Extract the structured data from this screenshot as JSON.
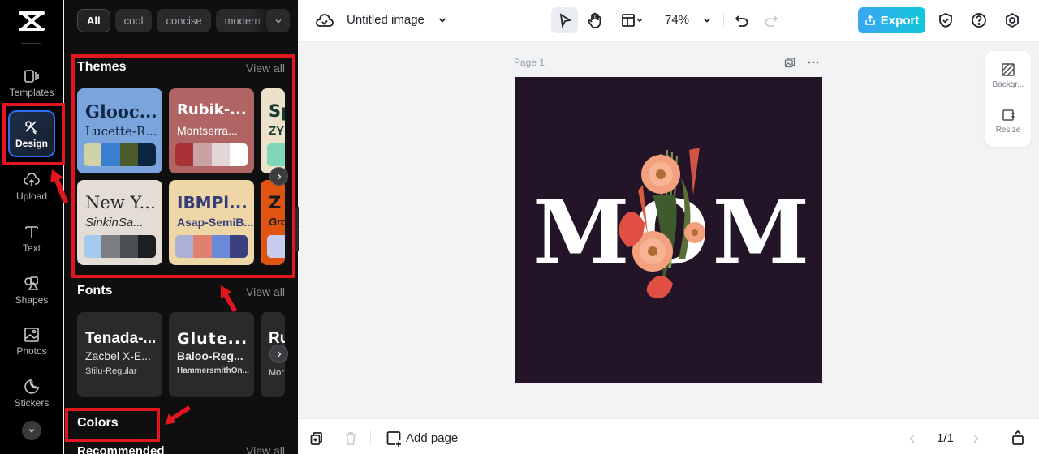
{
  "app": {
    "brand": "CapCut"
  },
  "rail": {
    "items": [
      {
        "label": "Templates",
        "icon": "templates-icon"
      },
      {
        "label": "Design",
        "icon": "design-icon",
        "active": true
      },
      {
        "label": "Upload",
        "icon": "upload-cloud-icon"
      },
      {
        "label": "Text",
        "icon": "text-icon"
      },
      {
        "label": "Shapes",
        "icon": "shapes-icon"
      },
      {
        "label": "Photos",
        "icon": "photos-icon"
      },
      {
        "label": "Stickers",
        "icon": "stickers-icon"
      }
    ],
    "more_icon": "chevron-down-icon"
  },
  "panel": {
    "filter_chips": [
      "All",
      "cool",
      "concise",
      "modern"
    ],
    "active_chip": "All",
    "themes": {
      "title": "Themes",
      "view_all": "View all",
      "cards": [
        {
          "heading": "Glooc...",
          "subheading": "Lucette-R...",
          "bg": "#7aa5dc",
          "fg": "#0f2744",
          "swatches": [
            "#cfd3a6",
            "#3b7fd0",
            "#4a5a2b",
            "#0b2640"
          ]
        },
        {
          "heading": "Rubik-...",
          "subheading": "Montserra...",
          "bg": "#b06464",
          "fg": "#ffffff",
          "swatches": [
            "#a83236",
            "#c9a3a3",
            "#e3d6d6",
            "#ffffff"
          ]
        },
        {
          "heading": "Sp",
          "subheading": "ZY",
          "bg": "#ece2cb",
          "fg": "#163a2f",
          "swatches": [
            "#80d6b8"
          ]
        },
        {
          "heading": "New Y...",
          "subheading": "SinkinSa...",
          "bg": "#e3ddd6",
          "fg": "#2a2a2a",
          "swatches": [
            "#a4c8ee",
            "#7b7e82",
            "#4b4f55",
            "#1c1f22"
          ]
        },
        {
          "heading": "IBMPl...",
          "subheading": "Asap-SemiB...",
          "bg": "#eed6a6",
          "fg": "#363e7a",
          "swatches": [
            "#aab0d6",
            "#df8070",
            "#6a8ad8",
            "#3a3f7e"
          ]
        },
        {
          "heading": "Z",
          "subheading": "Gro",
          "bg": "#df5410",
          "fg": "#1a1a1a",
          "swatches": [
            "#c8cdf0"
          ]
        }
      ]
    },
    "fonts": {
      "title": "Fonts",
      "view_all": "View all",
      "cards": [
        {
          "line1": "Tenada-...",
          "line2": "Zacbel X-E...",
          "line3": "Stilu-Regular"
        },
        {
          "line1": "Glute...",
          "line2": "Baloo-Reg...",
          "line3": "HammersmithOn..."
        },
        {
          "line1": "Ru",
          "line2": "",
          "line3": "Mor"
        }
      ]
    },
    "colors": {
      "title": "Colors",
      "recommended": "Recommended",
      "view_all": "View all"
    }
  },
  "topbar": {
    "title": "Untitled image",
    "zoom": "74%",
    "export_label": "Export"
  },
  "canvas": {
    "page_label": "Page 1",
    "artwork_text": "MOM",
    "artboard_color": "#231428",
    "side_tools": [
      {
        "label": "Backgr...",
        "icon": "background-icon"
      },
      {
        "label": "Resize",
        "icon": "resize-icon"
      }
    ]
  },
  "bottombar": {
    "add_page_label": "Add page",
    "page_counter": "1/1"
  },
  "colors": {
    "accent": "#2f6cf0",
    "annotation": "#e3151f",
    "export_gradient_start": "#3aa6f0",
    "export_gradient_end": "#10c6dc"
  }
}
